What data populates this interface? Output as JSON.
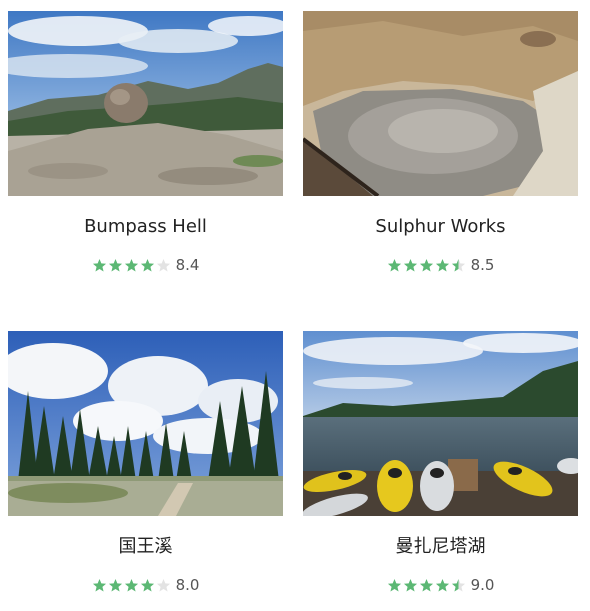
{
  "colors": {
    "star_filled": "#5cb874",
    "star_empty": "#e3e3e3"
  },
  "cards": [
    {
      "title": "Bumpass Hell",
      "rating": "8.4",
      "stars": 4.0,
      "photo_icon": "mountain-boulder-photo"
    },
    {
      "title": "Sulphur Works",
      "rating": "8.5",
      "stars": 4.5,
      "photo_icon": "mud-pot-photo"
    },
    {
      "title": "国王溪",
      "rating": "8.0",
      "stars": 4.0,
      "photo_icon": "meadow-forest-photo"
    },
    {
      "title": "曼扎尼塔湖",
      "rating": "9.0",
      "stars": 4.5,
      "photo_icon": "lake-kayaks-photo"
    }
  ]
}
